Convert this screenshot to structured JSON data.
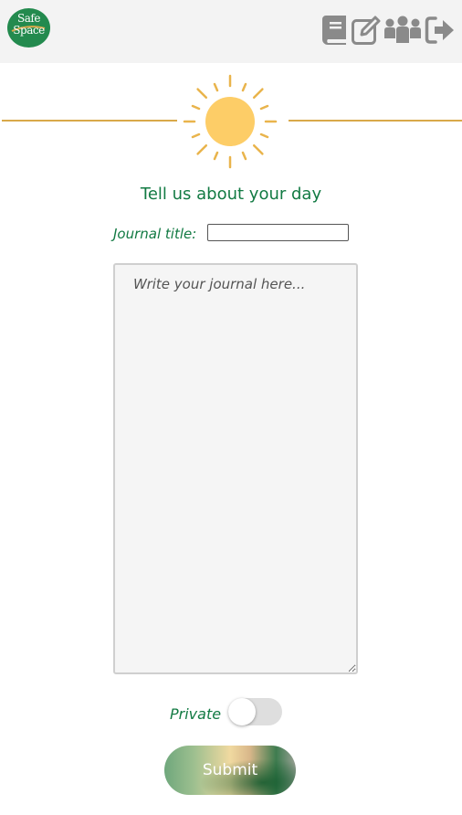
{
  "app": {
    "logo_text": "Safe\nSpace",
    "logo_color": "#238a4e",
    "accent_color": "#d9a94a"
  },
  "nav": {
    "icons": [
      "journal-book-icon",
      "edit-icon",
      "group-users-icon",
      "logout-icon"
    ],
    "icon_color": "#8a8a8a"
  },
  "main": {
    "heading": "Tell us about your day",
    "title_label": "Journal title:",
    "title_value": "",
    "journal_placeholder": "Write your journal here...",
    "journal_value": "",
    "private_label": "Private",
    "private_on": false,
    "submit_label": "Submit",
    "text_color": "#127a43",
    "sun_color": "#fdcd67"
  }
}
